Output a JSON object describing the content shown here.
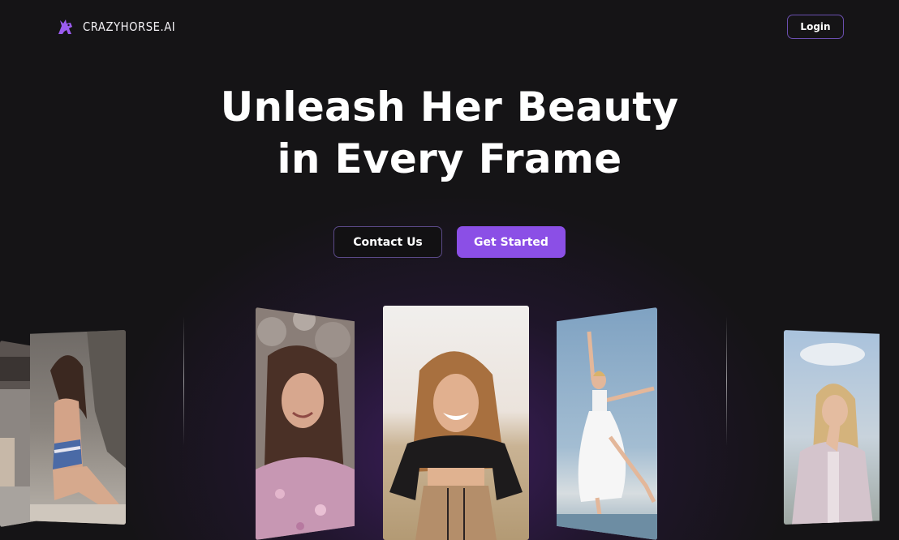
{
  "header": {
    "brand": "CRAZYHORSE.AI",
    "logo_icon": "horse-logo-icon",
    "login_label": "Login"
  },
  "hero": {
    "title_line1": "Unleash Her Beauty",
    "title_line2": "in Every Frame",
    "contact_label": "Contact Us",
    "start_label": "Get Started"
  },
  "gallery": {
    "cards": [
      {
        "name": "photo-beach-swimsuit"
      },
      {
        "name": "photo-flowers-brunette"
      },
      {
        "name": "photo-smiling-field"
      },
      {
        "name": "photo-ballet-leap"
      },
      {
        "name": "photo-blonde-coat"
      }
    ]
  },
  "colors": {
    "background": "#151416",
    "accent": "#8b4fe6",
    "outline": "#6b4fb0",
    "glow": "#5c2696"
  }
}
